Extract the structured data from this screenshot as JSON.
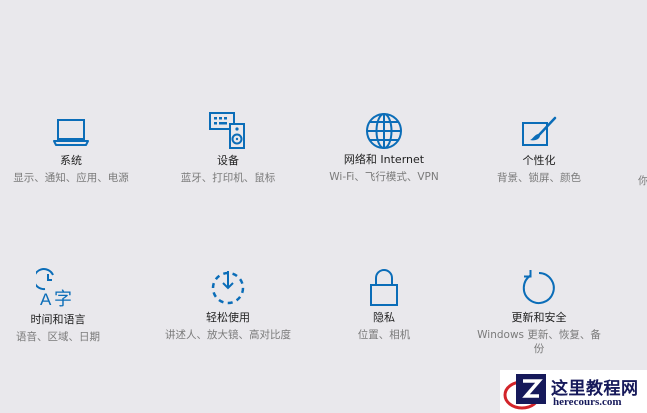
{
  "colors": {
    "background": "#e9e8ec",
    "accent": "#0b6db8",
    "title_text": "#1f1f1f",
    "desc_text": "#7a7a7a"
  },
  "tiles": [
    {
      "id": "system",
      "icon": "laptop-icon",
      "title": "系统",
      "desc": "显示、通知、应用、电源"
    },
    {
      "id": "devices",
      "icon": "devices-icon",
      "title": "设备",
      "desc": "蓝牙、打印机、鼠标"
    },
    {
      "id": "network",
      "icon": "globe-icon",
      "title": "网络和 Internet",
      "desc": "Wi-Fi、飞行模式、VPN"
    },
    {
      "id": "personalization",
      "icon": "paintbrush-icon",
      "title": "个性化",
      "desc": "背景、锁屏、颜色"
    },
    {
      "id": "time-language",
      "icon": "time-language-icon",
      "title": "时间和语言",
      "desc": "语音、区域、日期"
    },
    {
      "id": "ease-of-access",
      "icon": "ease-of-access-icon",
      "title": "轻松使用",
      "desc": "讲述人、放大镜、高对比度"
    },
    {
      "id": "privacy",
      "icon": "lock-icon",
      "title": "隐私",
      "desc": "位置、相机"
    },
    {
      "id": "update-security",
      "icon": "refresh-icon",
      "title": "更新和安全",
      "desc": "Windows 更新、恢复、备份"
    }
  ],
  "edge_text": "你",
  "watermark": {
    "main": "这里教程网",
    "sub": "herecours.com"
  }
}
